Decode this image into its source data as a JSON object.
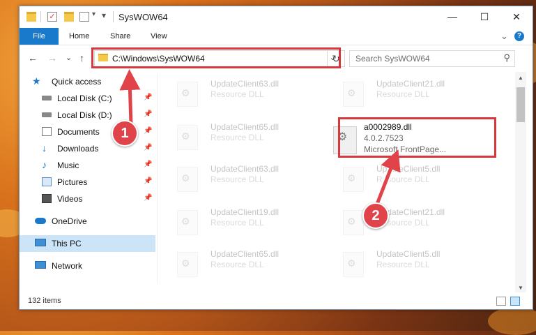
{
  "window": {
    "title": "SysWOW64",
    "controls": {
      "minimize": "—",
      "maximize": "☐",
      "close": "✕"
    }
  },
  "ribbon": {
    "file": "File",
    "tabs": [
      "Home",
      "Share",
      "View"
    ],
    "expand": "⌄",
    "help": "?"
  },
  "nav": {
    "back": "←",
    "forward": "→",
    "recent": "⌄",
    "up": "↑",
    "address": "C:\\Windows\\SysWOW64",
    "address_dropdown": "⌄",
    "refresh": "↻",
    "search_placeholder": "Search SysWOW64",
    "search_icon": "⚲"
  },
  "sidebar": {
    "items": [
      {
        "label": "Quick access",
        "icon": "star-icon",
        "pinned": false
      },
      {
        "label": "Local Disk (C:)",
        "icon": "drive-icon",
        "pinned": true
      },
      {
        "label": "Local Disk (D:)",
        "icon": "drive-icon",
        "pinned": true
      },
      {
        "label": "Documents",
        "icon": "documents-icon",
        "pinned": true
      },
      {
        "label": "Downloads",
        "icon": "download-icon",
        "pinned": true
      },
      {
        "label": "Music",
        "icon": "music-icon",
        "pinned": true
      },
      {
        "label": "Pictures",
        "icon": "pictures-icon",
        "pinned": true
      },
      {
        "label": "Videos",
        "icon": "videos-icon",
        "pinned": true
      },
      {
        "label": "OneDrive",
        "icon": "cloud-icon",
        "pinned": false
      },
      {
        "label": "This PC",
        "icon": "computer-icon",
        "pinned": false,
        "selected": true
      },
      {
        "label": "Network",
        "icon": "network-icon",
        "pinned": false
      }
    ],
    "pin_glyph": "📌"
  },
  "files": [
    {
      "name": "UpdateClient63.dll",
      "sub1": "Resource DLL",
      "faded": true
    },
    {
      "name": "UpdateClient21.dll",
      "sub1": "Resource DLL",
      "faded": true
    },
    {
      "name": "UpdateClient65.dll",
      "sub1": "Resource DLL",
      "faded": true
    },
    {
      "name": "a0002989.dll",
      "sub1": "4.0.2.7523",
      "sub2": "Microsoft FrontPage...",
      "faded": false,
      "highlighted": true
    },
    {
      "name": "UpdateClient63.dll",
      "sub1": "Resource DLL",
      "faded": true
    },
    {
      "name": "UpdateClient5.dll",
      "sub1": "Resource DLL",
      "faded": true
    },
    {
      "name": "UpdateClient19.dll",
      "sub1": "Resource DLL",
      "faded": true
    },
    {
      "name": "UpdateClient21.dll",
      "sub1": "Resource DLL",
      "faded": true
    },
    {
      "name": "UpdateClient65.dll",
      "sub1": "Resource DLL",
      "faded": true
    },
    {
      "name": "UpdateClient5.dll",
      "sub1": "Resource DLL",
      "faded": true
    }
  ],
  "status": {
    "item_count": "132 items"
  },
  "callouts": {
    "one": "1",
    "two": "2"
  },
  "colors": {
    "accent": "#1979ca",
    "highlight": "#d9363e",
    "selection": "#cce4f7",
    "callout": "#e0444a"
  }
}
